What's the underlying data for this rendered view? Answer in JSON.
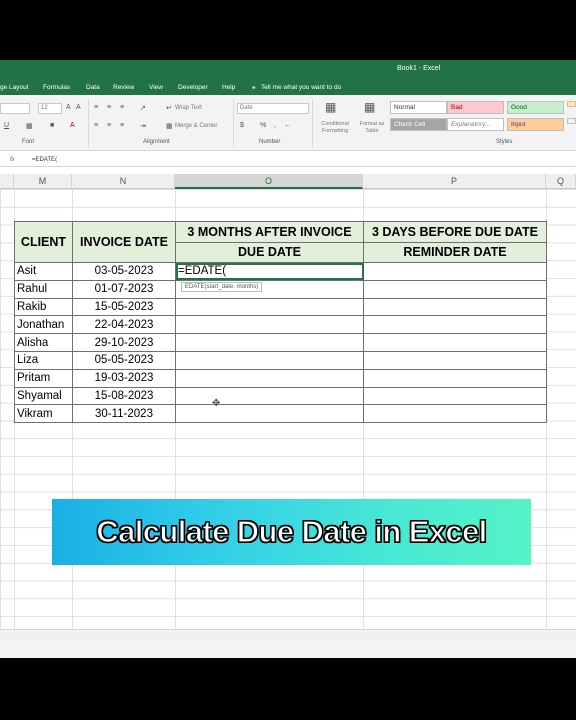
{
  "window": {
    "title": "Book1  -  Excel"
  },
  "menu": [
    "ge Layout",
    "Formulas",
    "Data",
    "Review",
    "View",
    "Developer",
    "Help",
    "Tell me what you want to do"
  ],
  "ribbon": {
    "font_size": "12",
    "wrap_text": "Wrap Text",
    "merge_center": "Merge & Center",
    "number_format": "Date",
    "conditional_formatting": "Conditional Formatting",
    "format_as_table": "Format as Table",
    "groups": {
      "font": "Font",
      "alignment": "Alignment",
      "number": "Number",
      "styles": "Styles"
    },
    "styles": [
      {
        "label": "Normal",
        "bg": "#ffffff",
        "fg": "#333333"
      },
      {
        "label": "Bad",
        "bg": "#ffc7ce",
        "fg": "#9c0006"
      },
      {
        "label": "Good",
        "bg": "#c6efce",
        "fg": "#006100"
      },
      {
        "label": "Check Cell",
        "bg": "#a5a5a5",
        "fg": "#ffffff"
      },
      {
        "label": "Explanatory...",
        "bg": "#ffffff",
        "fg": "#7f7f7f"
      },
      {
        "label": "Input",
        "bg": "#ffcc99",
        "fg": "#3f3f76"
      }
    ]
  },
  "formula_bar": {
    "fx": "fx",
    "value": "=EDATE("
  },
  "columns": [
    "M",
    "N",
    "O",
    "P",
    "Q"
  ],
  "table": {
    "headers": {
      "client": "CLIENT",
      "invoice_date": "INVOICE DATE",
      "due_line1": "3 MONTHS AFTER INVOICE",
      "due_line2": "DUE DATE",
      "reminder_line1": "3 DAYS BEFORE DUE DATE",
      "reminder_line2": "REMINDER DATE"
    },
    "rows": [
      {
        "client": "Asit",
        "invoice_date": "03-05-2023",
        "due_date": "=EDATE(",
        "reminder": ""
      },
      {
        "client": "Rahul",
        "invoice_date": "01-07-2023",
        "due_date": "",
        "reminder": ""
      },
      {
        "client": "Rakib",
        "invoice_date": "15-05-2023",
        "due_date": "",
        "reminder": ""
      },
      {
        "client": "Jonathan",
        "invoice_date": "22-04-2023",
        "due_date": "",
        "reminder": ""
      },
      {
        "client": "Alisha",
        "invoice_date": "29-10-2023",
        "due_date": "",
        "reminder": ""
      },
      {
        "client": "Liza",
        "invoice_date": "05-05-2023",
        "due_date": "",
        "reminder": ""
      },
      {
        "client": "Pritam",
        "invoice_date": "19-03-2023",
        "due_date": "",
        "reminder": ""
      },
      {
        "client": "Shyamal",
        "invoice_date": "15-08-2023",
        "due_date": "",
        "reminder": ""
      },
      {
        "client": "Vikram",
        "invoice_date": "30-11-2023",
        "due_date": "",
        "reminder": ""
      }
    ],
    "header_color": "#e2efda"
  },
  "tooltip": "EDATE(start_date, months)",
  "banner": {
    "text": "Calculate Due Date in Excel"
  },
  "accent": "#217346"
}
